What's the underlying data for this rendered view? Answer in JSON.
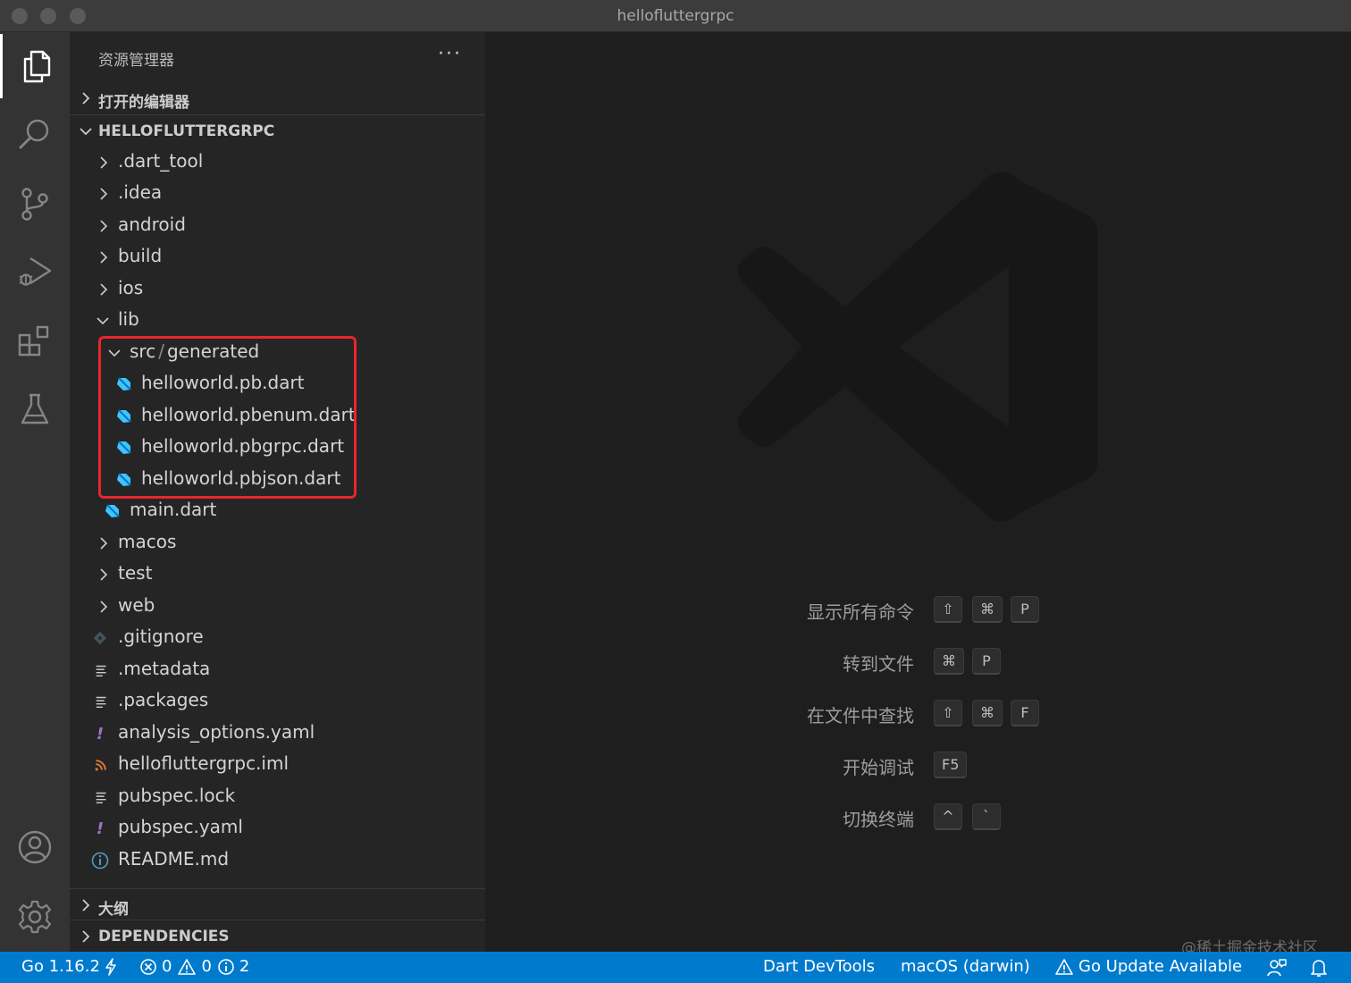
{
  "window": {
    "title": "hellofluttergrpc"
  },
  "activity_bar": {
    "items": [
      {
        "icon": "files-icon",
        "active": true
      },
      {
        "icon": "search-icon",
        "active": false
      },
      {
        "icon": "source-control-icon",
        "active": false
      },
      {
        "icon": "run-debug-icon",
        "active": false
      },
      {
        "icon": "extensions-icon",
        "active": false
      },
      {
        "icon": "testing-icon",
        "active": false
      }
    ],
    "bottom_items": [
      {
        "icon": "account-icon"
      },
      {
        "icon": "gear-icon"
      }
    ]
  },
  "sidebar": {
    "title": "资源管理器",
    "more_label": "···",
    "open_editors": "打开的编辑器",
    "project": "HELLOFLUTTERGRPC",
    "tree": [
      {
        "name": ".dart_tool",
        "type": "folder",
        "expanded": false
      },
      {
        "name": ".idea",
        "type": "folder",
        "expanded": false
      },
      {
        "name": "android",
        "type": "folder",
        "expanded": false
      },
      {
        "name": "build",
        "type": "folder",
        "expanded": false
      },
      {
        "name": "ios",
        "type": "folder",
        "expanded": false
      },
      {
        "name": "lib",
        "type": "folder",
        "expanded": true
      },
      {
        "name_parts": [
          "src",
          "/",
          "generated"
        ],
        "type": "folder",
        "expanded": true
      },
      {
        "name": "helloworld.pb.dart",
        "type": "dart"
      },
      {
        "name": "helloworld.pbenum.dart",
        "type": "dart"
      },
      {
        "name": "helloworld.pbgrpc.dart",
        "type": "dart"
      },
      {
        "name": "helloworld.pbjson.dart",
        "type": "dart"
      },
      {
        "name": "main.dart",
        "type": "dart"
      },
      {
        "name": "macos",
        "type": "folder",
        "expanded": false
      },
      {
        "name": "test",
        "type": "folder",
        "expanded": false
      },
      {
        "name": "web",
        "type": "folder",
        "expanded": false
      },
      {
        "name": ".gitignore",
        "type": "git"
      },
      {
        "name": ".metadata",
        "type": "text"
      },
      {
        "name": ".packages",
        "type": "text"
      },
      {
        "name": "analysis_options.yaml",
        "type": "yaml"
      },
      {
        "name": "hellofluttergrpc.iml",
        "type": "rss"
      },
      {
        "name": "pubspec.lock",
        "type": "text"
      },
      {
        "name": "pubspec.yaml",
        "type": "yaml"
      },
      {
        "name": "README.md",
        "type": "info"
      }
    ],
    "outline": "大纲",
    "dependencies": "DEPENDENCIES"
  },
  "editor": {
    "shortcuts": [
      {
        "label": "显示所有命令",
        "keys": [
          "⇧",
          "⌘",
          "P"
        ]
      },
      {
        "label": "转到文件",
        "keys": [
          "⌘",
          "P"
        ]
      },
      {
        "label": "在文件中查找",
        "keys": [
          "⇧",
          "⌘",
          "F"
        ]
      },
      {
        "label": "开始调试",
        "keys": [
          "F5"
        ]
      },
      {
        "label": "切换终端",
        "keys": [
          "^",
          "`"
        ]
      }
    ]
  },
  "status_bar": {
    "go_version": "Go 1.16.2",
    "errors": "0",
    "warnings": "0",
    "infos": "2",
    "dart_devtools": "Dart DevTools",
    "platform": "macOS (darwin)",
    "go_update": "Go Update Available"
  },
  "watermark": "@稀土掘金技术社区",
  "colors": {
    "statusbar": "#007acc",
    "highlight": "#e8262a",
    "dart": "#40c4ff",
    "yaml": "#a074c4",
    "rss": "#e37933"
  }
}
